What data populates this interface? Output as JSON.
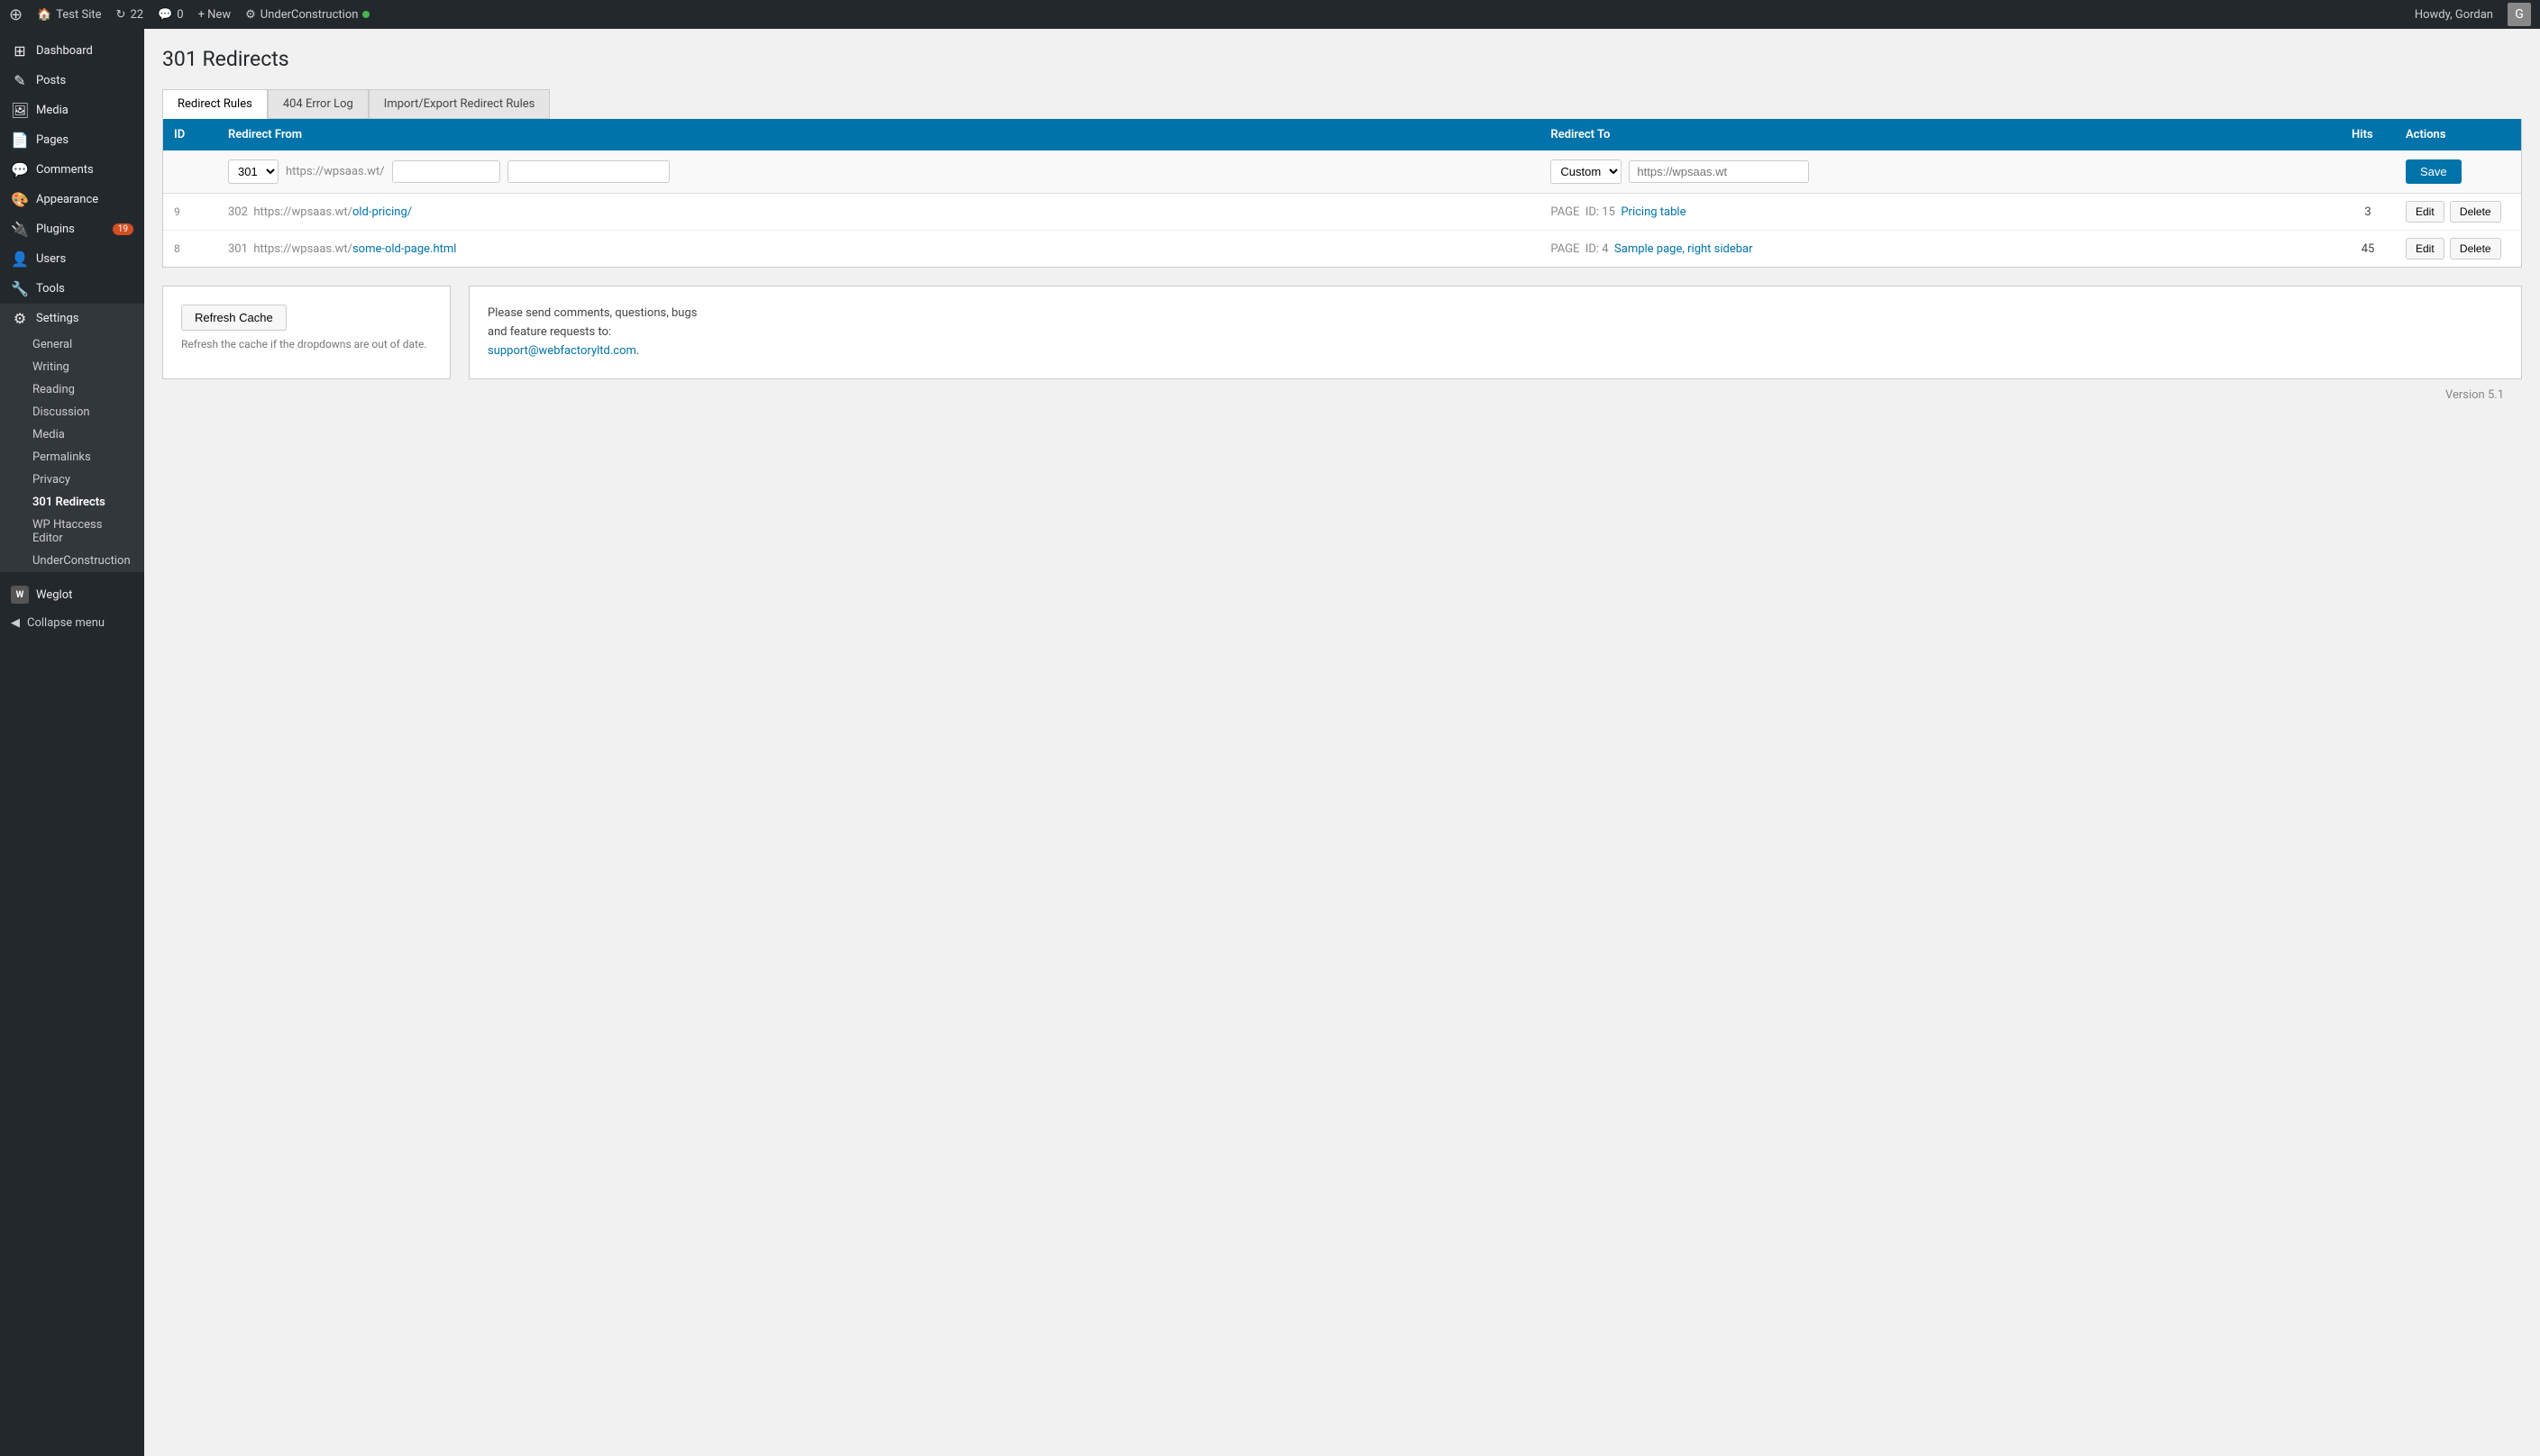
{
  "adminbar": {
    "site_name": "Test Site",
    "updates_count": "22",
    "comments_count": "0",
    "new_label": "+ New",
    "plugin_label": "UnderConstruction",
    "greeting": "Howdy, Gordan",
    "wp_icon": "⊕"
  },
  "sidebar": {
    "items": [
      {
        "id": "dashboard",
        "label": "Dashboard",
        "icon": "⊞"
      },
      {
        "id": "posts",
        "label": "Posts",
        "icon": "✎"
      },
      {
        "id": "media",
        "label": "Media",
        "icon": "🖼"
      },
      {
        "id": "pages",
        "label": "Pages",
        "icon": "📄"
      },
      {
        "id": "comments",
        "label": "Comments",
        "icon": "💬"
      },
      {
        "id": "appearance",
        "label": "Appearance",
        "icon": "🎨"
      },
      {
        "id": "plugins",
        "label": "Plugins",
        "icon": "🔌",
        "badge": "19"
      },
      {
        "id": "users",
        "label": "Users",
        "icon": "👤"
      },
      {
        "id": "tools",
        "label": "Tools",
        "icon": "🔧"
      },
      {
        "id": "settings",
        "label": "Settings",
        "icon": "⚙"
      }
    ],
    "settings_submenu": [
      {
        "id": "general",
        "label": "General"
      },
      {
        "id": "writing",
        "label": "Writing"
      },
      {
        "id": "reading",
        "label": "Reading"
      },
      {
        "id": "discussion",
        "label": "Discussion"
      },
      {
        "id": "media",
        "label": "Media"
      },
      {
        "id": "permalinks",
        "label": "Permalinks"
      },
      {
        "id": "privacy",
        "label": "Privacy"
      },
      {
        "id": "301-redirects",
        "label": "301 Redirects",
        "active": true
      },
      {
        "id": "wp-htaccess",
        "label": "WP Htaccess Editor"
      },
      {
        "id": "underconstruction",
        "label": "UnderConstruction"
      }
    ],
    "weglot_label": "Weglot",
    "collapse_label": "Collapse menu"
  },
  "page": {
    "title": "301 Redirects",
    "tabs": [
      {
        "id": "redirect-rules",
        "label": "Redirect Rules",
        "active": true
      },
      {
        "id": "404-error-log",
        "label": "404 Error Log",
        "active": false
      },
      {
        "id": "import-export",
        "label": "Import/Export Redirect Rules",
        "active": false
      }
    ]
  },
  "table": {
    "headers": {
      "id": "ID",
      "redirect_from": "Redirect From",
      "redirect_to": "Redirect To",
      "hits": "Hits",
      "actions": "Actions"
    },
    "add_row": {
      "code_value": "301",
      "url_prefix": "https://wpsaas.wt/",
      "path_placeholder": "",
      "query_placeholder": "",
      "type_value": "Custom",
      "dest_placeholder": "https://wpsaas.wt",
      "save_label": "Save"
    },
    "rows": [
      {
        "row_num": "9",
        "code": "302",
        "url_base": "https://wpsaas.wt/",
        "url_path": "old-pricing/",
        "page_label": "PAGE",
        "page_id": "ID: 15",
        "page_name": "Pricing table",
        "hits": "3",
        "edit_label": "Edit",
        "delete_label": "Delete"
      },
      {
        "row_num": "8",
        "code": "301",
        "url_base": "https://wpsaas.wt/",
        "url_path": "some-old-page.html",
        "page_label": "PAGE",
        "page_id": "ID: 4",
        "page_name": "Sample page, right sidebar",
        "hits": "45",
        "edit_label": "Edit",
        "delete_label": "Delete"
      }
    ]
  },
  "refresh_card": {
    "button_label": "Refresh Cache",
    "description": "Refresh the cache if the dropdowns are out of date."
  },
  "info_card": {
    "text_1": "Please send comments, questions, bugs",
    "text_2": "and feature requests to:",
    "link_text": "support@webfactoryltd.com",
    "link_href": "mailto:support@webfactoryltd.com",
    "text_3": "."
  },
  "footer": {
    "version": "Version 5.1"
  }
}
